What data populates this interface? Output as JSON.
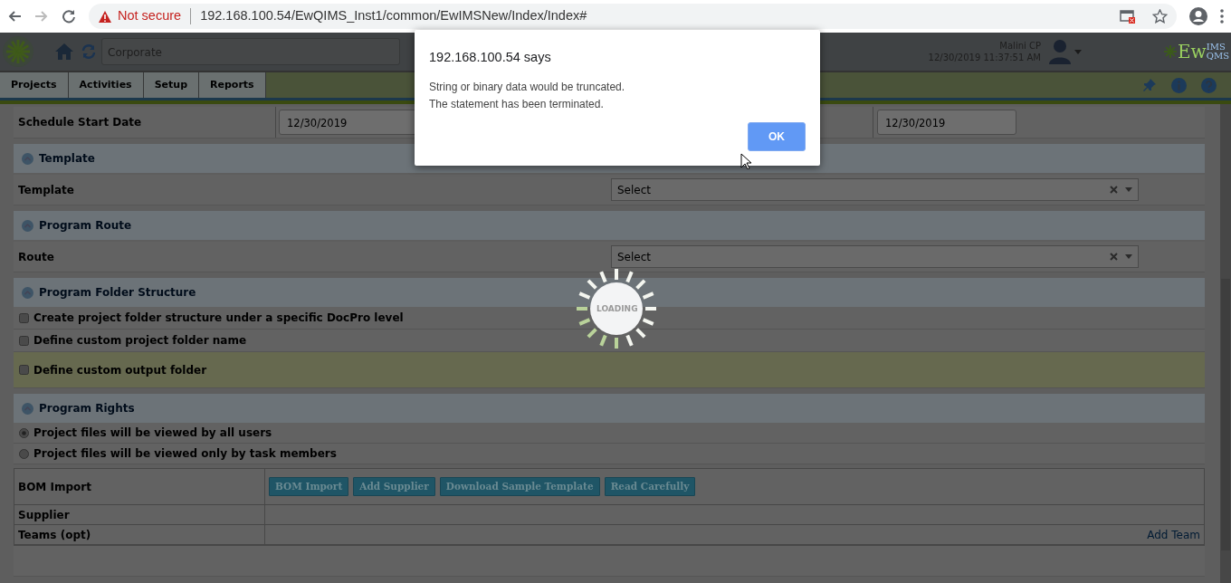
{
  "browser": {
    "security": "Not secure",
    "url": "192.168.100.54/EwQIMS_Inst1/common/EwIMSNew/Index/Index#"
  },
  "header": {
    "location": "Corporate",
    "user": "Malini CP",
    "datetime": "12/30/2019 11:37:51 AM",
    "logo_main": "Ew",
    "logo_top": "IMS",
    "logo_bottom": "QMS"
  },
  "nav": {
    "tabs": [
      {
        "label": "Projects",
        "selected": false
      },
      {
        "label": "Activities",
        "selected": false
      },
      {
        "label": "Setup",
        "selected": false
      },
      {
        "label": "Reports",
        "selected": false
      }
    ]
  },
  "form": [
    {
      "kind": "dates",
      "label": "Schedule Start Date",
      "start": "12/30/2019",
      "end": "12/30/2019"
    },
    {
      "kind": "section",
      "title": "Template",
      "expanded": true
    },
    {
      "kind": "select",
      "label": "Template",
      "value": "Select"
    },
    {
      "kind": "section",
      "title": "Program Route",
      "expanded": true
    },
    {
      "kind": "select",
      "label": "Route",
      "value": "Select"
    },
    {
      "kind": "section",
      "title": "Program Folder Structure",
      "expanded": true
    },
    {
      "kind": "checkbox",
      "label": "Create project folder structure under a specific DocPro level",
      "checked": false,
      "highlighted": false
    },
    {
      "kind": "checkbox",
      "label": "Define custom project folder name",
      "checked": false,
      "highlighted": false
    },
    {
      "kind": "checkbox",
      "label": "Define custom output folder",
      "checked": false,
      "highlighted": true
    },
    {
      "kind": "section",
      "title": "Program Rights",
      "expanded": true
    },
    {
      "kind": "radio",
      "label": "Project files will be viewed by all users",
      "selected": true
    },
    {
      "kind": "radio",
      "label": "Project files will be viewed only by task members",
      "selected": false
    }
  ],
  "bom": {
    "rows": [
      {
        "label": "BOM Import",
        "buttons": [
          "BOM Import",
          "Add Supplier",
          "Download Sample Template",
          "Read Carefully"
        ]
      },
      {
        "label": "Supplier"
      },
      {
        "label": "Teams (opt)",
        "link": "Add Team"
      }
    ]
  },
  "dialog": {
    "title": "192.168.100.54 says",
    "lines": [
      "String or binary data would be truncated.",
      "The statement has been terminated."
    ],
    "button": "OK"
  },
  "loading": {
    "label": "LOADING"
  }
}
